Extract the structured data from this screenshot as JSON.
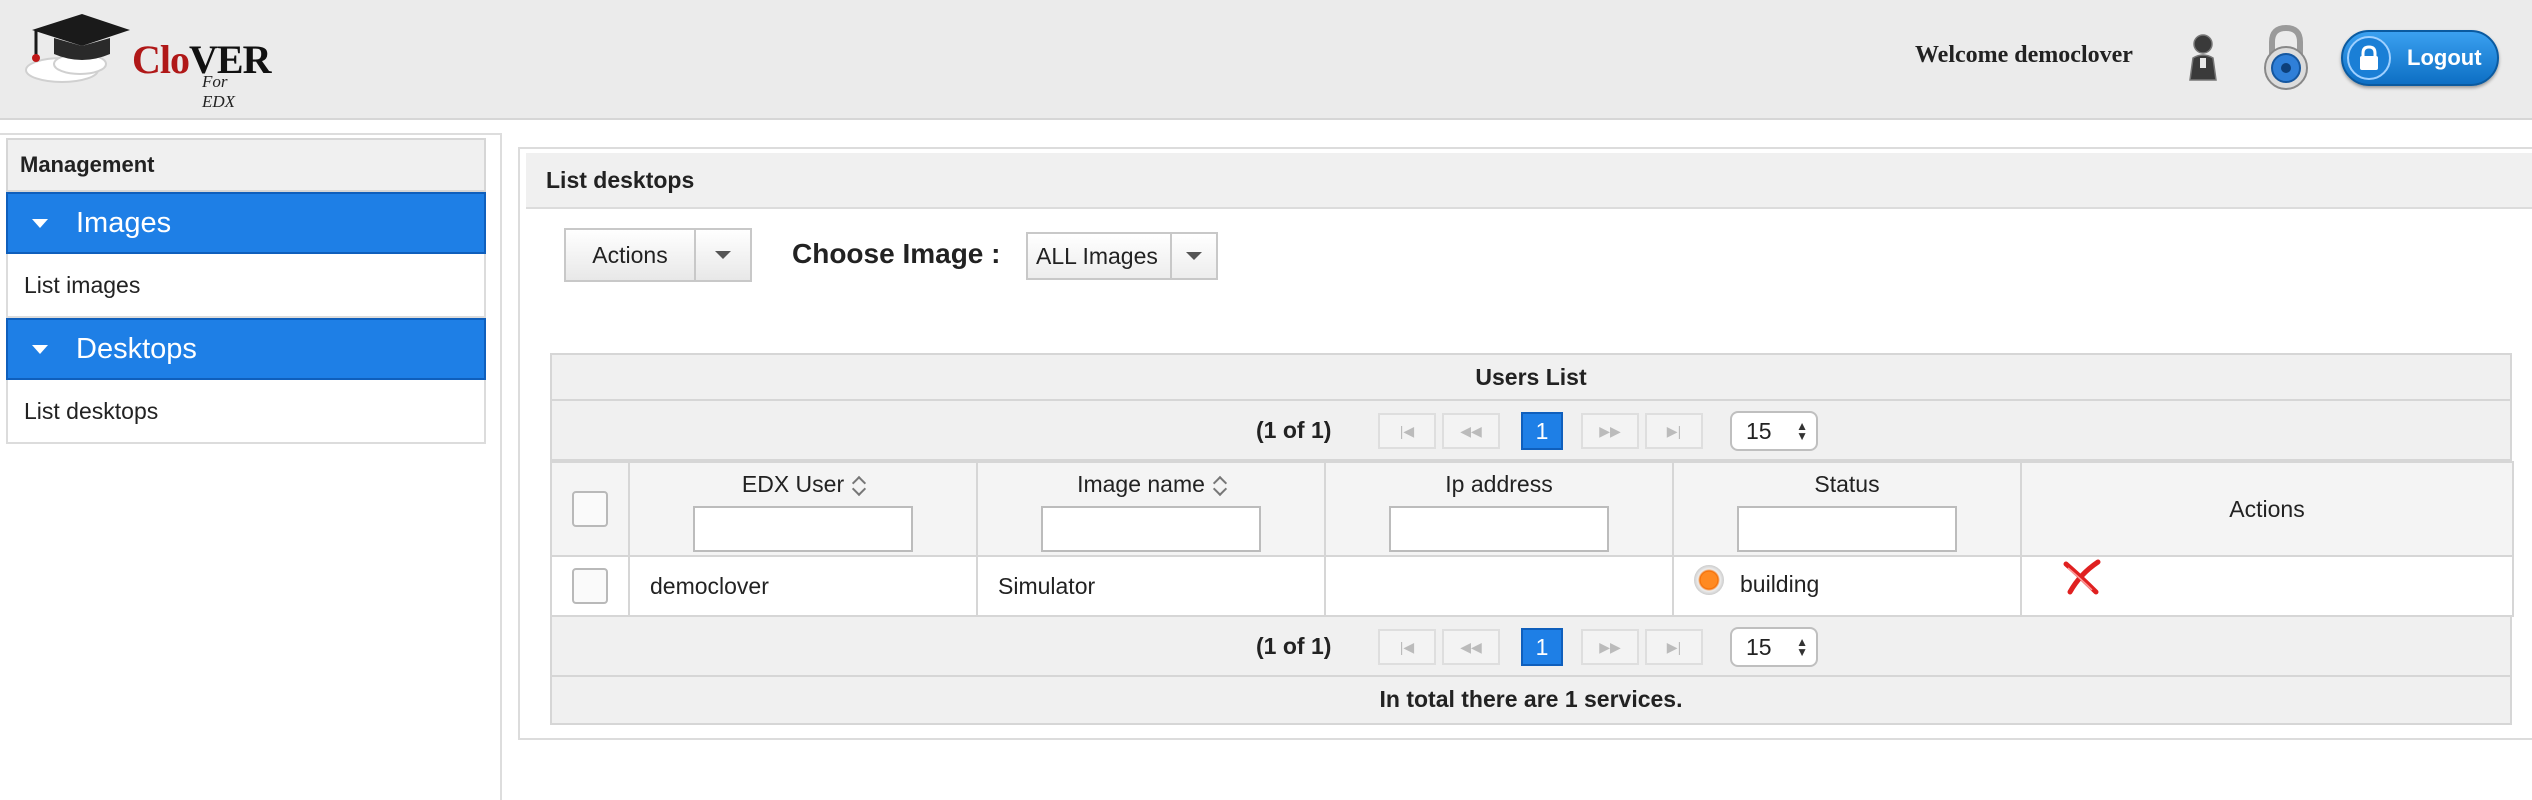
{
  "header": {
    "logo_main": "Clo",
    "logo_main_b": "VER",
    "logo_sub": "For EDX",
    "welcome": "Welcome democlover",
    "logout_label": "Logout"
  },
  "sidebar": {
    "title": "Management",
    "groups": [
      {
        "label": "Images",
        "items": [
          {
            "label": "List images"
          }
        ]
      },
      {
        "label": "Desktops",
        "items": [
          {
            "label": "List desktops"
          }
        ]
      }
    ]
  },
  "panel": {
    "title": "List desktops",
    "actions_label": "Actions",
    "choose_label": "Choose Image :",
    "image_selected": "ALL Images"
  },
  "grid": {
    "title": "Users List",
    "page_info": "(1 of 1)",
    "current_page": "1",
    "rows_per_page": "15",
    "columns": [
      "EDX User",
      "Image name",
      "Ip address",
      "Status",
      "Actions"
    ],
    "rows": [
      {
        "user": "democlover",
        "image": "Simulator",
        "ip": "",
        "status": "building"
      }
    ],
    "total": "In total there are 1 services."
  },
  "colors": {
    "accent": "#1e7fe6",
    "logo_red": "#b01818",
    "status_building": "#f46b00",
    "delete_red": "#e02020"
  }
}
